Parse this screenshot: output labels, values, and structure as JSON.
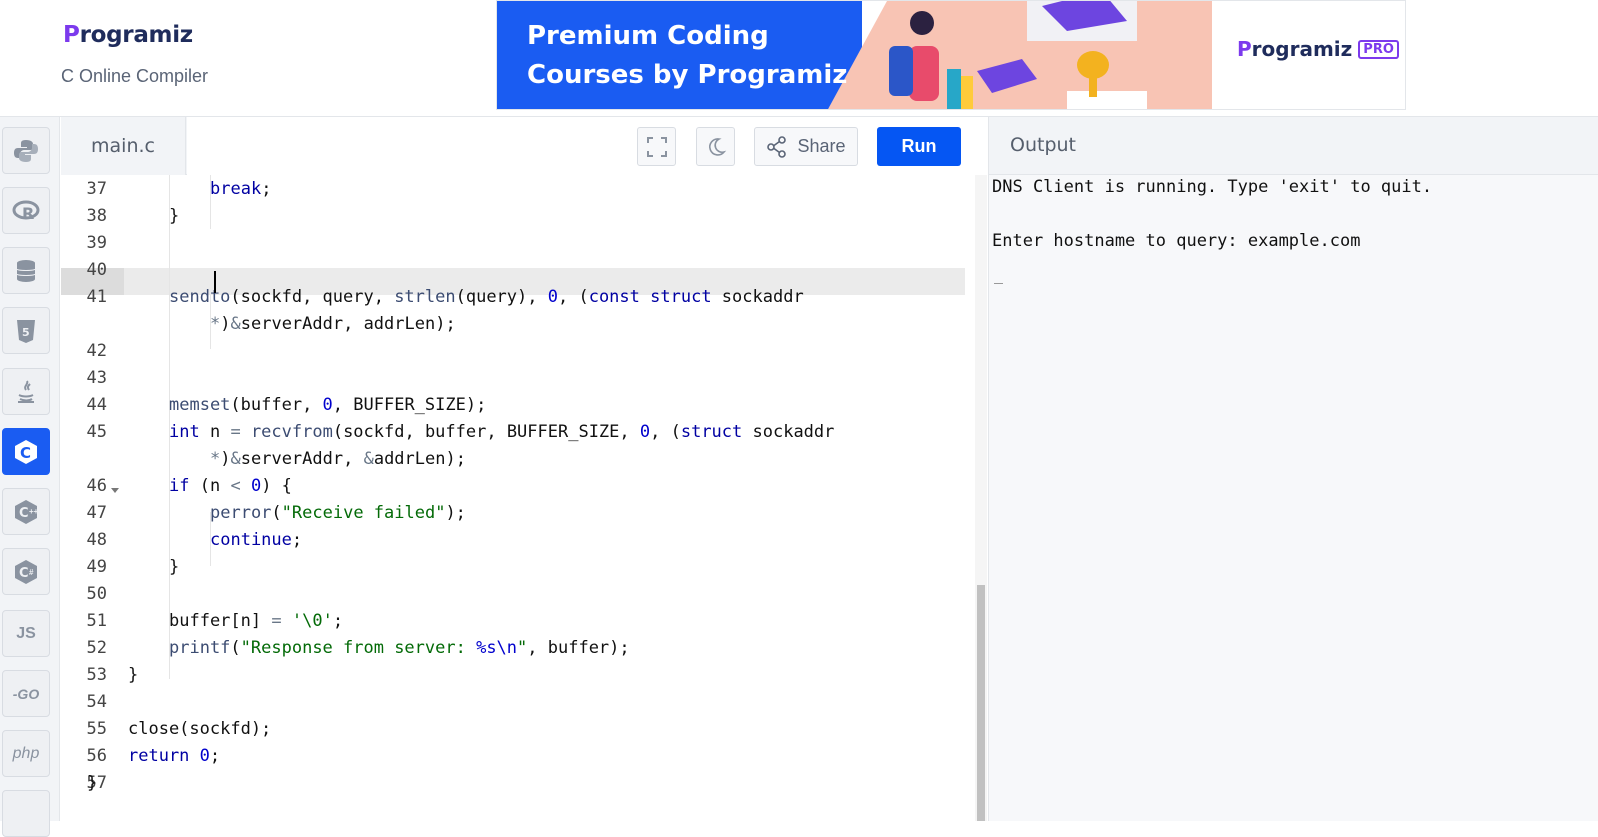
{
  "header": {
    "brand_first": "P",
    "brand_rest": "rogramiz",
    "subtitle": "C Online Compiler"
  },
  "banner": {
    "line1": "Premium Coding",
    "line2": "Courses by Programiz",
    "pro_brand_first": "P",
    "pro_brand_rest": "rogramiz",
    "pro_badge": "PRO"
  },
  "sidebar": {
    "items": [
      {
        "name": "python-icon"
      },
      {
        "name": "r-icon",
        "label": "R"
      },
      {
        "name": "sql-database-icon"
      },
      {
        "name": "html5-icon",
        "label": "5"
      },
      {
        "name": "java-icon"
      },
      {
        "name": "c-icon",
        "label": "C",
        "active": true
      },
      {
        "name": "cpp-icon",
        "label": "C"
      },
      {
        "name": "csharp-icon",
        "label": "C"
      },
      {
        "name": "javascript-icon",
        "label": "JS"
      },
      {
        "name": "go-icon",
        "label": "-GO"
      },
      {
        "name": "php-icon",
        "label": "php"
      }
    ]
  },
  "editor": {
    "filename": "main.c",
    "share_label": "Share",
    "run_label": "Run",
    "line_numbers": [
      "37",
      "38",
      "39",
      "40",
      "41",
      "",
      "42",
      "43",
      "44",
      "45",
      "",
      "46",
      "47",
      "48",
      "49",
      "50",
      "51",
      "52",
      "53",
      "54",
      "55",
      "56",
      "57"
    ]
  },
  "output": {
    "title": "Output",
    "lines": [
      "DNS Client is running. Type 'exit' to quit.",
      "",
      "Enter hostname to query: example.com"
    ]
  },
  "colors": {
    "accent": "#0556f3",
    "brand_purple": "#7c3aed",
    "keyword": "#0000a2",
    "string": "#036a07"
  }
}
